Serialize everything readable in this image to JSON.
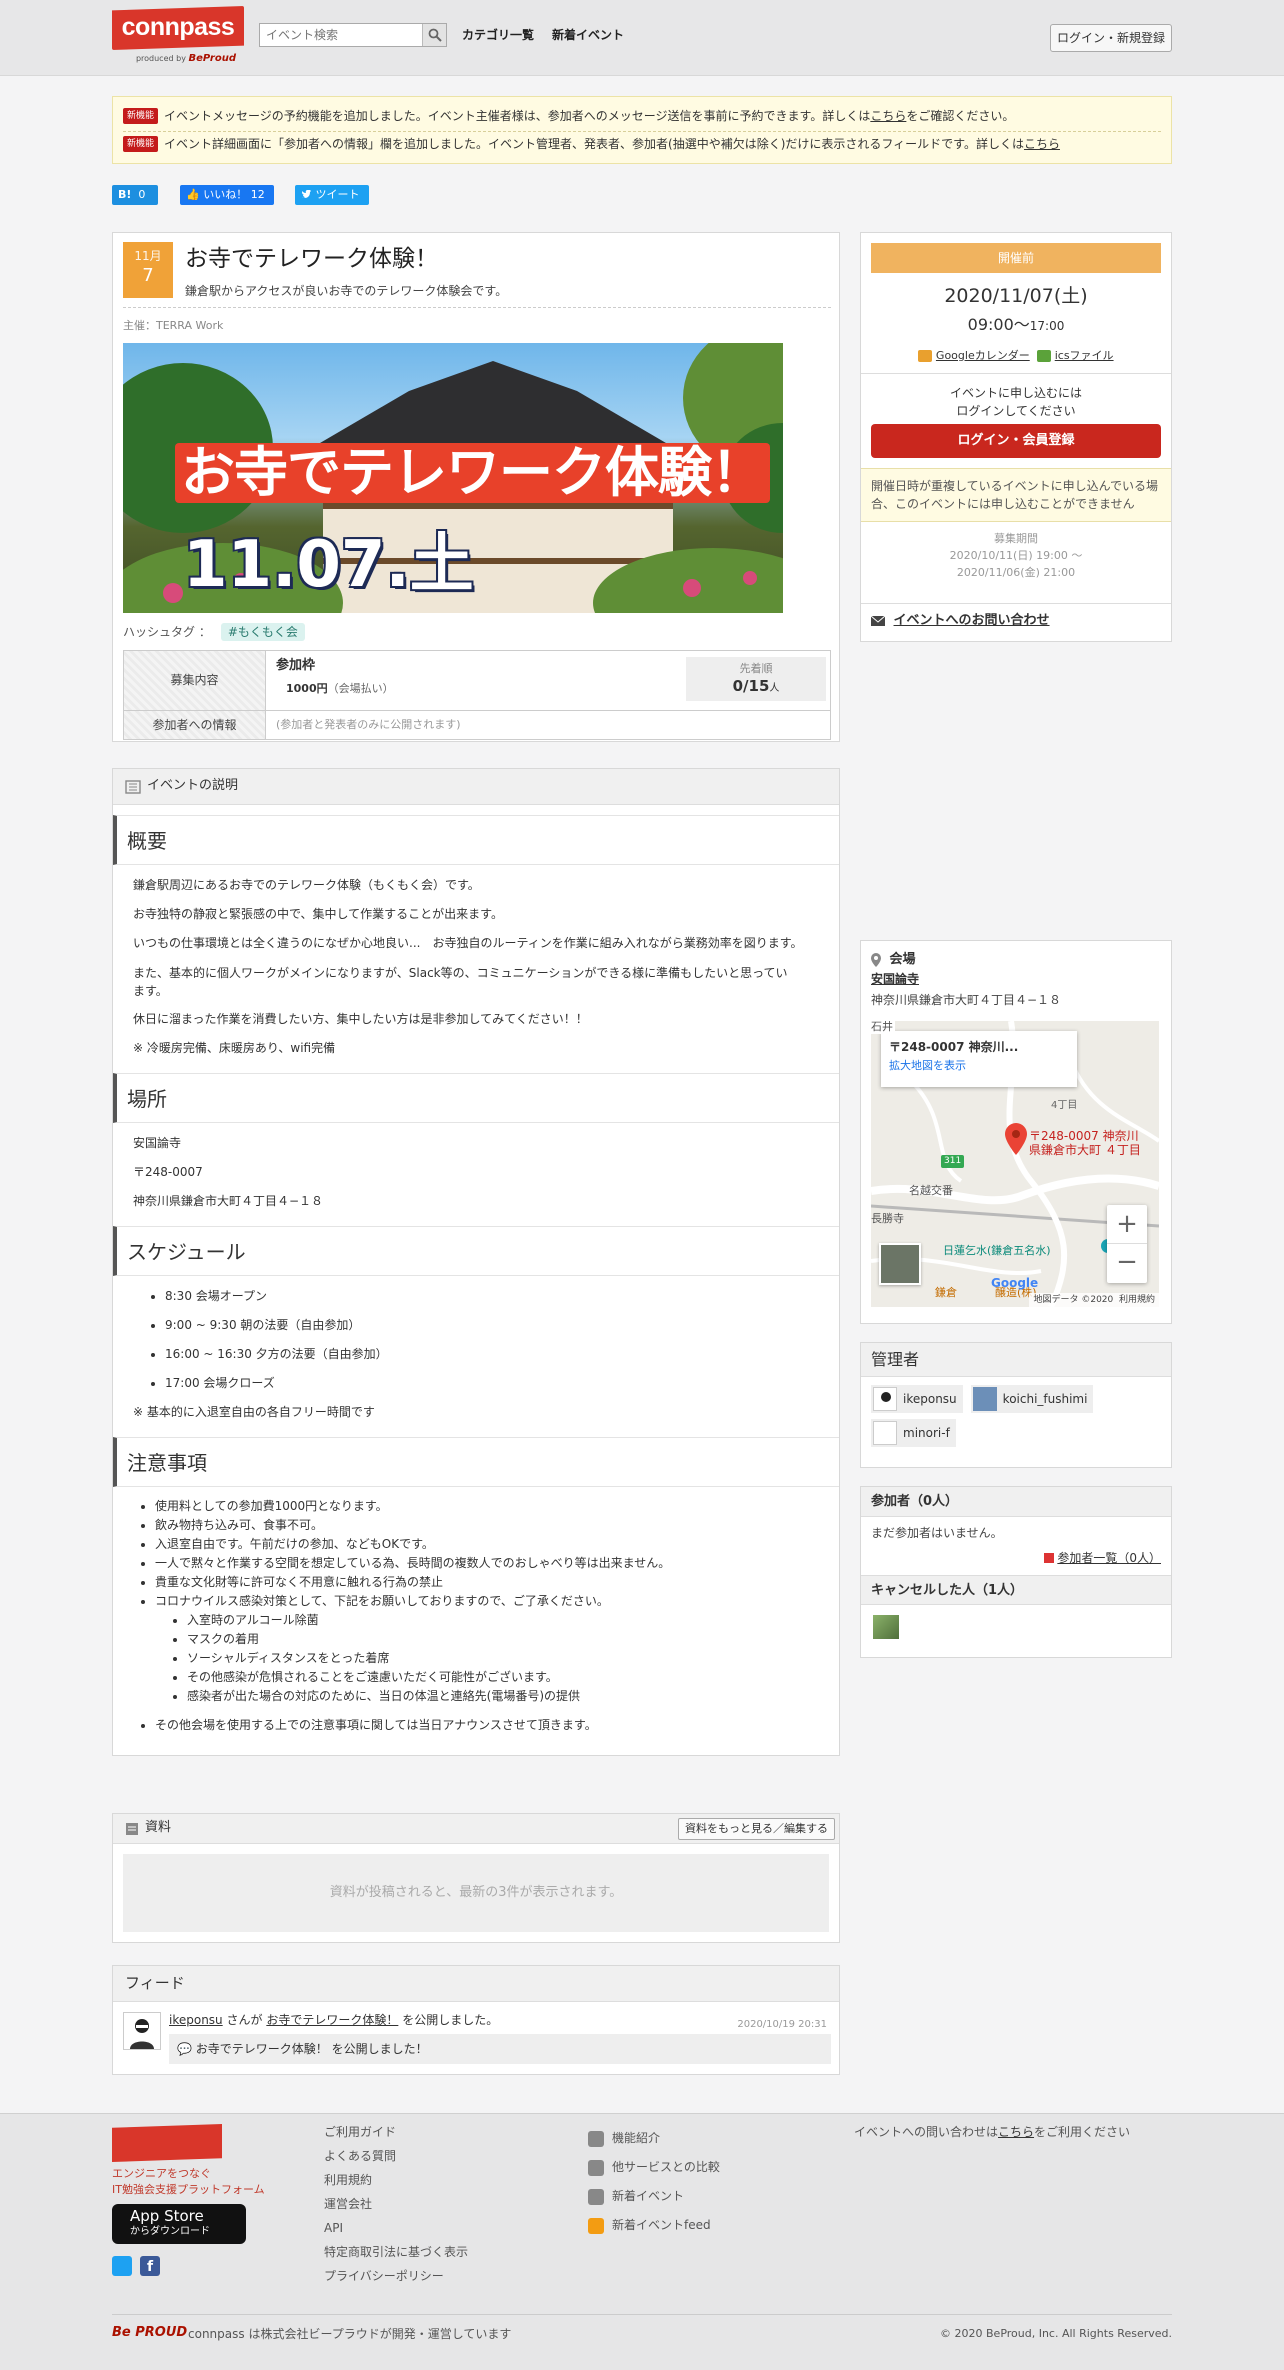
{
  "header": {
    "logo_text": "connpass",
    "produced_by": "produced by",
    "produced_brand": "BeProud",
    "search_placeholder": "イベント検索",
    "nav_categories": "カテゴリ一覧",
    "nav_new_events": "新着イベント",
    "login_button": "ログイン・新規登録"
  },
  "notices": [
    {
      "badge": "新機能",
      "text_before": "イベントメッセージの予約機能を追加しました。イベント主催者様は、参加者へのメッセージ送信を事前に予約できます。詳しくは",
      "link": "こちら",
      "text_after": "をご確認ください。"
    },
    {
      "badge": "新機能",
      "text_before": "イベント詳細画面に「参加者への情報」欄を追加しました。イベント管理者、発表者、参加者(抽選中や補欠は除く)だけに表示されるフィールドです。詳しくは",
      "link": "こちら",
      "text_after": ""
    }
  ],
  "social": {
    "hatena_label": "B!",
    "hatena_count": "0",
    "like_label": "いいね！",
    "like_count": "12",
    "tweet_label": "ツイート"
  },
  "event": {
    "month": "11月",
    "day": "7",
    "title": "お寺でテレワーク体験！",
    "subtitle": "鎌倉駅からアクセスが良いお寺でのテレワーク体験会です。",
    "organizer": "主催：TERRA Work",
    "hero_text_1": "お寺でテレワーク体験！",
    "hero_text_2": "11.07.土",
    "hashtag_label": "ハッシュタグ ：",
    "hashtag": "#もくもく会",
    "recruit_label": "募集内容",
    "frame_name": "参加枠",
    "frame_price": "1000円",
    "frame_price_note": "（会場払い）",
    "frame_method": "先着順",
    "frame_count": "0/15",
    "frame_unit": "人",
    "info_label": "参加者への情報",
    "info_value": "(参加者と発表者のみに公開されます)"
  },
  "description": {
    "header": "イベントの説明",
    "overview_heading": "概要",
    "overview": [
      "鎌倉駅周辺にあるお寺でのテレワーク体験（もくもく会）です。",
      "お寺独特の静寂と緊張感の中で、集中して作業することが出来ます。",
      "いつもの仕事環境とは全く違うのになぜか心地良い...　お寺独自のルーティンを作業に組み入れながら業務効率を図ります。",
      "また、基本的に個人ワークがメインになりますが、Slack等の、コミュニケーションができる様に準備もしたいと思っています。",
      "休日に溜まった作業を消費したい方、集中したい方は是非参加してみてください！！",
      "※ 冷暖房完備、床暖房あり、wifi完備"
    ],
    "place_heading": "場所",
    "place": [
      "安国論寺",
      "〒248-0007",
      "神奈川県鎌倉市大町４丁目４−１８"
    ],
    "schedule_heading": "スケジュール",
    "schedule": [
      "8:30 会場オープン",
      "9:00 ~ 9:30 朝の法要（自由参加）",
      "16:00 ~ 16:30 夕方の法要（自由参加）",
      "17:00 会場クローズ"
    ],
    "schedule_note": "※ 基本的に入退室自由の各自フリー時間です",
    "notes_heading": "注意事項",
    "notes": [
      "使用料としての参加費1000円となります。",
      "飲み物持ち込み可、食事不可。",
      "入退室自由です。午前だけの参加、などもOKです。",
      "一人で黙々と作業する空間を想定している為、長時間の複数人でのおしゃべり等は出来ません。",
      "貴重な文化財等に許可なく不用意に触れる行為の禁止",
      "コロナウイルス感染対策として、下記をお願いしておりますので、ご了承ください。"
    ],
    "covid": [
      "入室時のアルコール除菌",
      "マスクの着用",
      "ソーシャルディスタンスをとった着席",
      "その他感染が危惧されることをご遠慮いただく可能性がございます。",
      "感染者が出た場合の対応のために、当日の体温と連絡先(電場番号)の提供"
    ],
    "notes_last": "その他会場を使用する上での注意事項に関しては当日アナウンスさせて頂きます。"
  },
  "materials": {
    "header": "資料",
    "more_button": "資料をもっと見る／編集する",
    "empty": "資料が投稿されると、最新の3件が表示されます。"
  },
  "feed": {
    "header": "フィード",
    "user": "ikeponsu",
    "san": "さんが",
    "event_link": "お寺でテレワーク体験！",
    "action": "を公開しました。",
    "time": "2020/10/19 20:31",
    "comment": "お寺でテレワーク体験！ を公開しました！"
  },
  "sidebar": {
    "status": "開催前",
    "date": "2020/11/07(土)",
    "time_start": "09:00",
    "time_sep": "～",
    "time_end": "17:00",
    "google_cal": "Googleカレンダー",
    "ics": "icsファイル",
    "apply_line1": "イベントに申し込むには",
    "apply_line2": "ログインしてください",
    "login_register": "ログイン・会員登録",
    "warning": "開催日時が重複しているイベントに申し込んでいる場合、このイベントには申し込むことができません",
    "period_label": "募集期間",
    "period_start": "2020/10/11(日) 19:00 ～",
    "period_end": "2020/11/06(金) 21:00",
    "contact": "イベントへのお問い合わせ",
    "venue_label": "会場",
    "venue_name": "安国論寺",
    "venue_address": "神奈川県鎌倉市大町４丁目４−１８",
    "map_popup_title": "〒248-0007 神奈川...",
    "map_popup_link": "拡大地図を表示",
    "map_pin_label_1": "〒248-0007 神奈川",
    "map_pin_label_2": "県鎌倉市大町 ４丁目",
    "map_label_4chome": "4丁目",
    "map_label_ishi": "名越交番",
    "map_label_chosho": "長勝寺",
    "map_label_nichiren": "日蓮乞水(鎌倉五名水)",
    "map_label_kamakura": "鎌倉",
    "map_label_sotoba": "醸造(株)",
    "map_label_311": "311",
    "map_label_ishii": "石井",
    "map_google": "Google",
    "map_data": "地図データ ©2020",
    "map_terms": "利用規約",
    "admins_label": "管理者",
    "admins": [
      "ikeponsu",
      "koichi_fushimi",
      "minori-f"
    ],
    "participants_label": "参加者（0人）",
    "participants_empty": "まだ参加者はいません。",
    "participants_list": "参加者一覧（0人）",
    "cancelled_label": "キャンセルした人（1人）"
  },
  "footer": {
    "tagline1": "エンジニアをつなぐ",
    "tagline2": "IT勉強会支援プラットフォーム",
    "appstore_1": "App Store",
    "appstore_2": "からダウンロード",
    "col1": [
      "ご利用ガイド",
      "よくある質問",
      "利用規約",
      "運営会社",
      "API",
      "特定商取引法に基づく表示",
      "プライバシーポリシー"
    ],
    "col2": [
      "機能紹介",
      "他サービスとの比較",
      "新着イベント",
      "新着イベントfeed"
    ],
    "contact_before": "イベントへの問い合わせは",
    "contact_link": "こちら",
    "contact_after": "をご利用ください",
    "bottom_brand": "Be PROUD",
    "bottom_text": "connpass は株式会社ビープラウドが開発・運営しています",
    "copyright": "© 2020 BeProud, Inc. All Rights Reserved."
  }
}
